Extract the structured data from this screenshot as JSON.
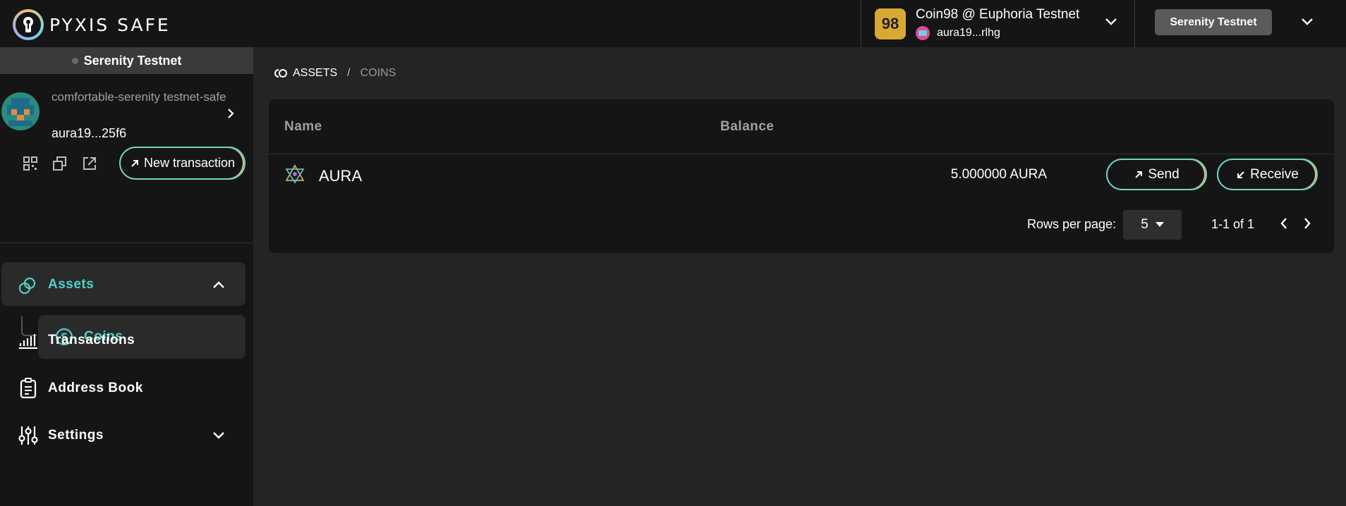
{
  "header": {
    "logo_text": "PYXIS SAFE",
    "wallet_name": "Coin98 @ Euphoria Testnet",
    "wallet_addr": "aura19...rlhg",
    "wallet_icon_text": "98",
    "network_button": "Serenity Testnet"
  },
  "sidebar": {
    "network_label": "Serenity Testnet",
    "safe_name": "comfortable-serenity testnet-safe",
    "safe_addr": "aura19...25f6",
    "new_tx_label": "New transaction",
    "nav": {
      "assets": "Assets",
      "coins": "Coins",
      "transactions": "Transactions",
      "address_book": "Address Book",
      "settings": "Settings"
    }
  },
  "main": {
    "breadcrumb": {
      "assets": "ASSETS",
      "sep": "/",
      "coins": "COINS"
    },
    "table": {
      "headers": {
        "name": "Name",
        "balance": "Balance"
      },
      "rows": [
        {
          "name": "AURA",
          "balance": "5.000000 AURA",
          "send": "Send",
          "receive": "Receive"
        }
      ]
    },
    "pagination": {
      "rows_label": "Rows per page:",
      "rows_value": "5",
      "range": "1-1 of 1"
    }
  },
  "colors": {
    "accent": "#4fd1c5",
    "gold": "#e8b87a",
    "bg": "#242424",
    "panel": "#151515"
  }
}
